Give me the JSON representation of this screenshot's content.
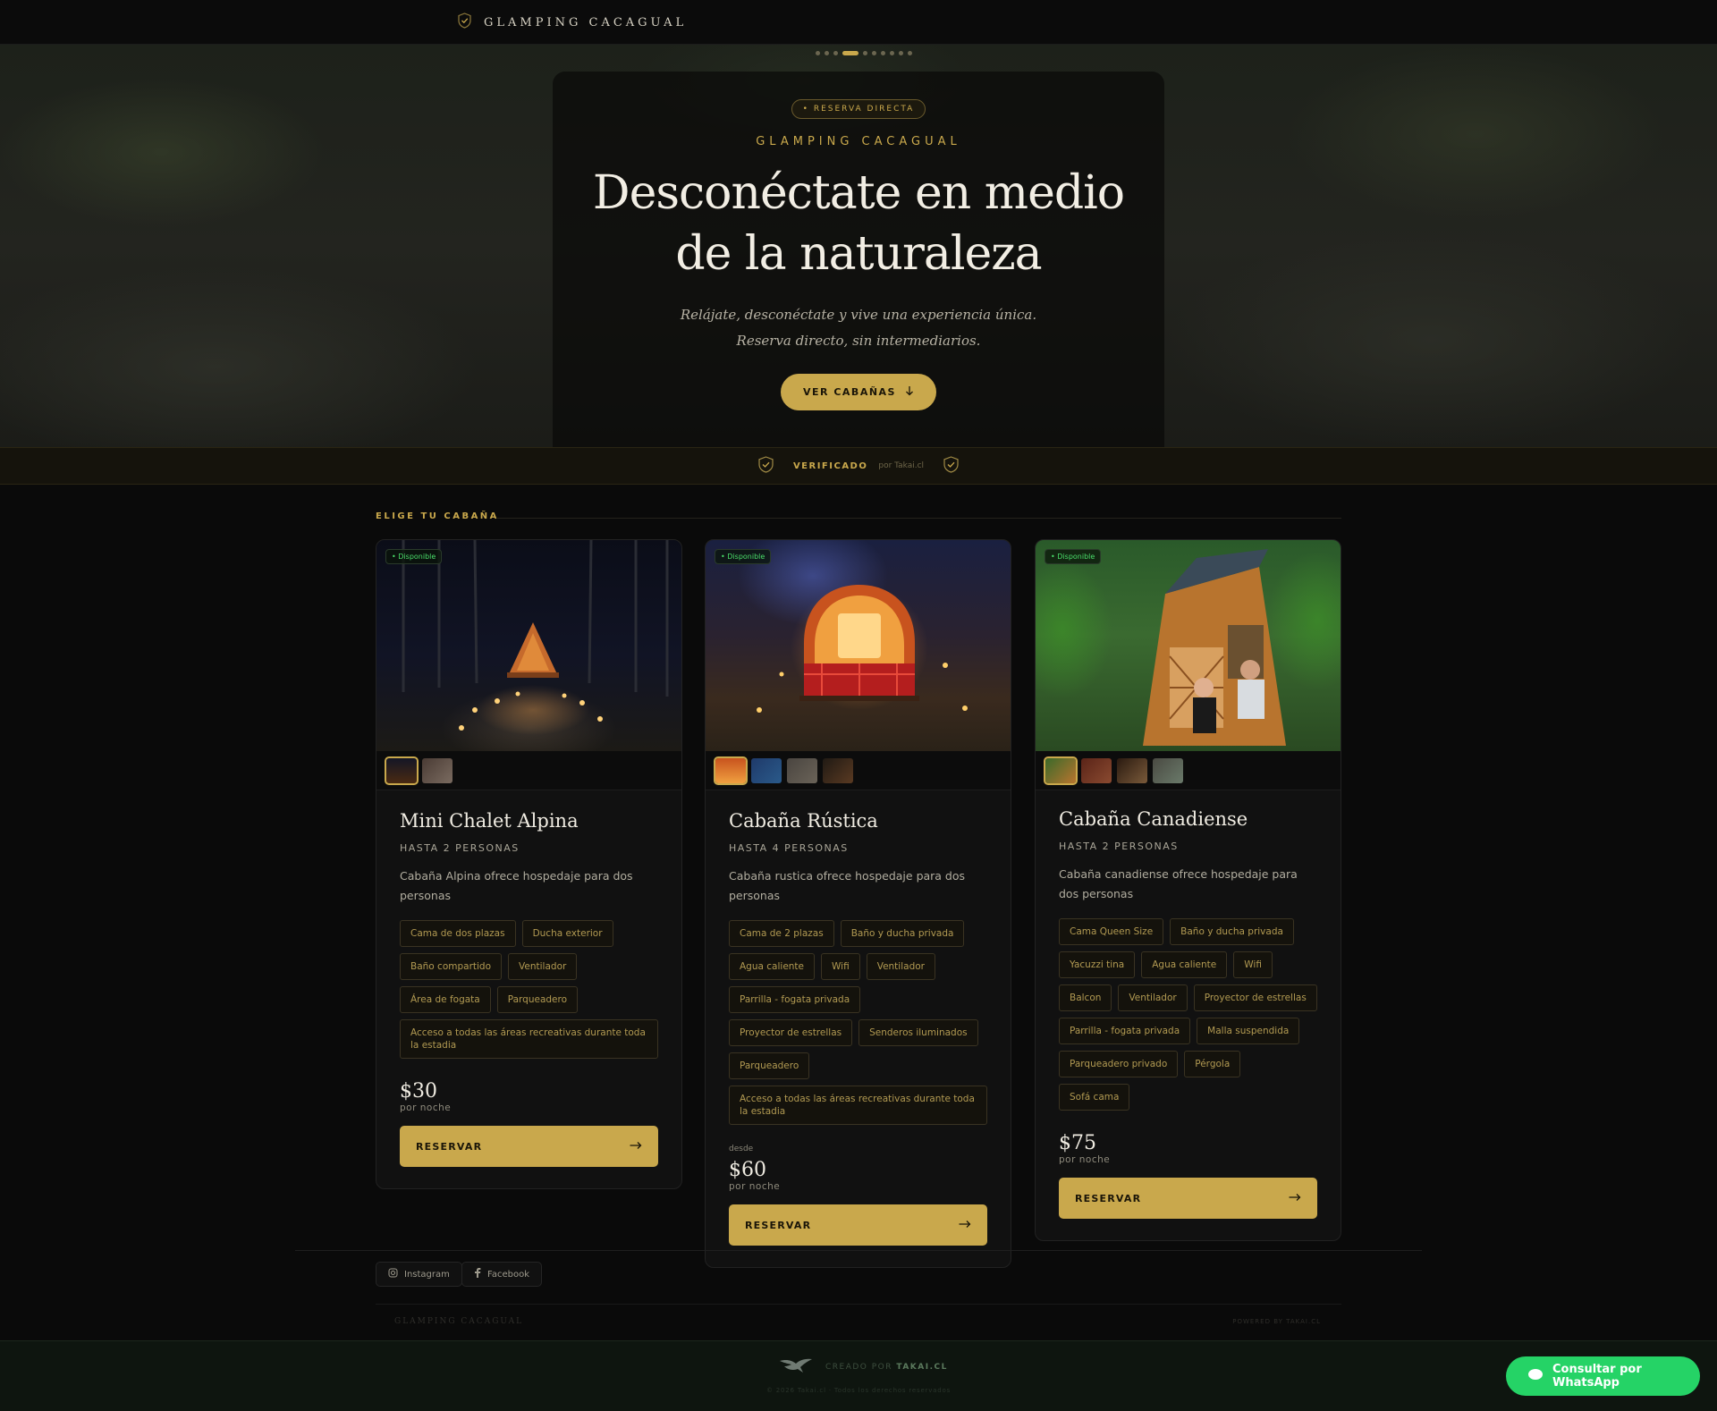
{
  "nav": {
    "brand": "GLAMPING CACAGUAL"
  },
  "hero": {
    "carousel_total": 10,
    "carousel_active": 3,
    "pill": "• RESERVA DIRECTA",
    "subtitle": "GLAMPING CACAGUAL",
    "title_line1": "Desconéctate en medio",
    "title_line2": "de la naturaleza",
    "desc_line1": "Relájate, desconéctate y vive una experiencia única.",
    "desc_line2": "Reserva directo, sin intermediarios.",
    "cta": "VER CABAÑAS"
  },
  "verify": {
    "label": "VERIFICADO",
    "by": "por Takai.cl"
  },
  "section": {
    "label": "ELIGE TU CABAÑA"
  },
  "cards": [
    {
      "badge": "• Disponible",
      "title": "Mini Chalet Alpina",
      "capacity": "HASTA 2 PERSONAS",
      "description": "Cabaña Alpina ofrece hospedaje para dos personas",
      "tags": [
        "Cama de dos plazas",
        "Ducha exterior",
        "Baño compartido",
        "Ventilador",
        "Área de fogata",
        "Parqueadero",
        "Acceso a todas las áreas recreativas durante toda la estadia"
      ],
      "desde": "",
      "price": "$30",
      "per_night": "por noche",
      "button": "RESERVAR"
    },
    {
      "badge": "• Disponible",
      "title": "Cabaña Rústica",
      "capacity": "HASTA 4 PERSONAS",
      "description": "Cabaña rustica ofrece hospedaje para dos personas",
      "tags": [
        "Cama de 2 plazas",
        "Baño y ducha privada",
        "Agua caliente",
        "Wifi",
        "Ventilador",
        "Parrilla - fogata privada",
        "Proyector de estrellas",
        "Senderos iluminados",
        "Parqueadero",
        "Acceso a todas las áreas recreativas durante toda la estadia"
      ],
      "desde": "desde",
      "price": "$60",
      "per_night": "por noche",
      "button": "RESERVAR"
    },
    {
      "badge": "• Disponible",
      "title": "Cabaña Canadiense",
      "capacity": "HASTA 2 PERSONAS",
      "description": "Cabaña canadiense ofrece hospedaje para dos personas",
      "tags": [
        "Cama Queen Size",
        "Baño y ducha privada",
        "Yacuzzi tina",
        "Agua caliente",
        "Wifi",
        "Balcon",
        "Ventilador",
        "Proyector de estrellas",
        "Parrilla - fogata privada",
        "Malla suspendida",
        "Parqueadero privado",
        "Pérgola",
        "Sofá cama"
      ],
      "desde": "",
      "price": "$75",
      "per_night": "por noche",
      "button": "RESERVAR"
    }
  ],
  "footer": {
    "instagram": "Instagram",
    "facebook": "Facebook",
    "brand": "GLAMPING CACAGUAL",
    "powered": "POWERED BY TAKAI.CL",
    "creado_prefix": "CREADO POR",
    "creado_brand": "TAKAI.CL",
    "copyright": "© 2026 Takai.cl · Todos los derechos reservados"
  },
  "whatsapp": {
    "label": "Consultar por WhatsApp"
  },
  "colors": {
    "accent": "#c9a84c",
    "available": "#4ade6a",
    "whatsapp": "#25d366"
  },
  "icons": [
    "shield-check-icon",
    "arrow-down-icon",
    "arrow-right-icon",
    "instagram-icon",
    "facebook-icon",
    "takai-bird-logo",
    "chat-bubble-icon"
  ]
}
